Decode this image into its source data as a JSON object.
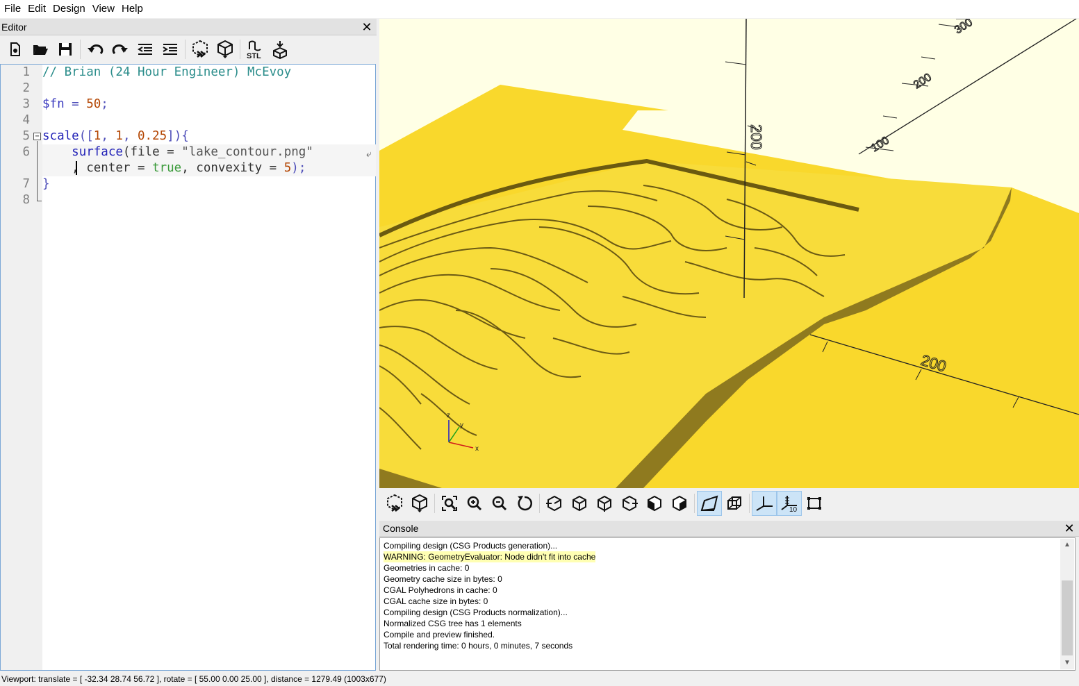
{
  "menu": [
    "File",
    "Edit",
    "Design",
    "View",
    "Help"
  ],
  "editor": {
    "title": "Editor",
    "close_icon": "close-icon",
    "line_numbers": [
      "1",
      "2",
      "3",
      "4",
      "5",
      "6",
      "",
      "7",
      "8"
    ],
    "lines": {
      "l1_comment": "// Brian (24 Hour Engineer) McEvoy",
      "l3_var": "$fn",
      "l3_eq": " = ",
      "l3_num": "50",
      "l3_semi": ";",
      "l5_fn": "scale",
      "l5_open": "([",
      "l5_n1": "1",
      "l5_c1": ", ",
      "l5_n2": "1",
      "l5_c2": ", ",
      "l5_n3": "0.25",
      "l5_close": "]){",
      "l6_indent": "    ",
      "l6_fn": "surface",
      "l6_open": "(file = ",
      "l6_str": "\"lake_contour.png\"",
      "l6b_indent": "    ",
      "l6b_a": ", center = ",
      "l6b_kw": "true",
      "l6b_b": ", convexity = ",
      "l6b_num": "5",
      "l6b_end": ");",
      "l7_close": "}"
    }
  },
  "viewport": {
    "background": "#ffffe5",
    "model_color": "#f9d82c",
    "axis_label_y": "200",
    "axis_label_z": "200",
    "axis_label_x": "200",
    "axis_label_top1": "300",
    "axis_label_top2": "200",
    "axis_label_top3": "100",
    "gizmo": {
      "x": "x",
      "y": "y",
      "z": "z"
    }
  },
  "view_toolbar": {
    "buttons": [
      "preview-icon",
      "render-icon",
      "view-all-icon",
      "zoom-in-icon",
      "zoom-out-icon",
      "reset-view-icon",
      "view-right-icon",
      "view-top-icon",
      "view-bottom-icon",
      "view-left-icon",
      "view-front-icon",
      "view-back-icon",
      "perspective-icon",
      "orthogonal-icon",
      "show-axes-icon",
      "show-scale-markers-icon",
      "show-edges-icon"
    ],
    "scale_marker_label": "10"
  },
  "console": {
    "title": "Console",
    "lines": [
      "Compiling design (CSG Products generation)...",
      "WARNING: GeometryEvaluator: Node didn't fit into cache",
      "Geometries in cache: 0",
      "Geometry cache size in bytes: 0",
      "CGAL Polyhedrons in cache: 0",
      "CGAL cache size in bytes: 0",
      "Compiling design (CSG Products normalization)...",
      "Normalized CSG tree has 1 elements",
      "Compile and preview finished.",
      "Total rendering time: 0 hours, 0 minutes, 7 seconds"
    ]
  },
  "status": "Viewport: translate = [ -32.34 28.74 56.72 ], rotate = [ 55.00 0.00 25.00 ], distance = 1279.49 (1003x677)"
}
